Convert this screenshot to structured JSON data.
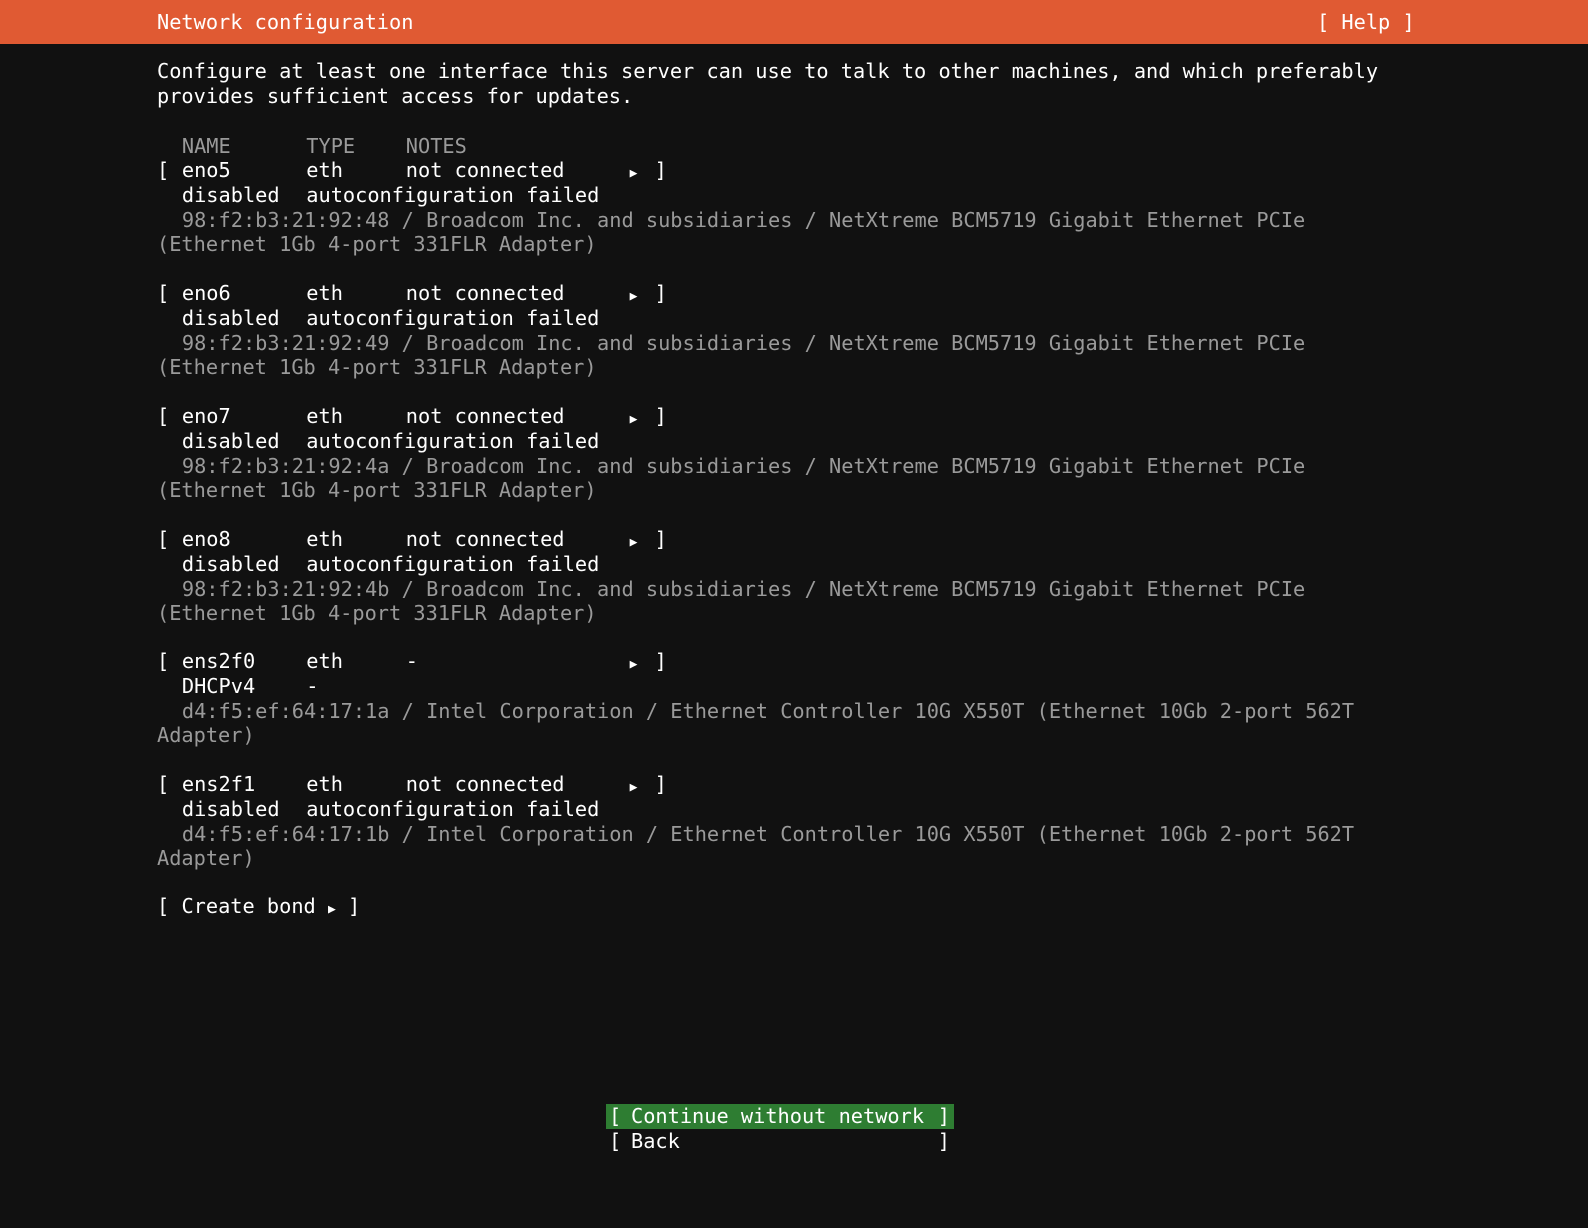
{
  "header": {
    "title": "Network configuration",
    "help_label": "[ Help ]",
    "color": "#e05a33"
  },
  "intro": "Configure at least one interface this server can use to talk to other machines, and which preferably\nprovides sufficient access for updates.",
  "columns": {
    "name": "NAME",
    "type": "TYPE",
    "notes": "NOTES"
  },
  "interfaces": [
    {
      "name": "eno5",
      "type": "eth",
      "notes": "not connected",
      "state": "disabled",
      "state_note": "autoconfiguration failed",
      "hw_line1": "98:f2:b3:21:92:48 / Broadcom Inc. and subsidiaries / NetXtreme BCM5719 Gigabit Ethernet PCIe",
      "hw_line2": "(Ethernet 1Gb 4-port 331FLR Adapter)"
    },
    {
      "name": "eno6",
      "type": "eth",
      "notes": "not connected",
      "state": "disabled",
      "state_note": "autoconfiguration failed",
      "hw_line1": "98:f2:b3:21:92:49 / Broadcom Inc. and subsidiaries / NetXtreme BCM5719 Gigabit Ethernet PCIe",
      "hw_line2": "(Ethernet 1Gb 4-port 331FLR Adapter)"
    },
    {
      "name": "eno7",
      "type": "eth",
      "notes": "not connected",
      "state": "disabled",
      "state_note": "autoconfiguration failed",
      "hw_line1": "98:f2:b3:21:92:4a / Broadcom Inc. and subsidiaries / NetXtreme BCM5719 Gigabit Ethernet PCIe",
      "hw_line2": "(Ethernet 1Gb 4-port 331FLR Adapter)"
    },
    {
      "name": "eno8",
      "type": "eth",
      "notes": "not connected",
      "state": "disabled",
      "state_note": "autoconfiguration failed",
      "hw_line1": "98:f2:b3:21:92:4b / Broadcom Inc. and subsidiaries / NetXtreme BCM5719 Gigabit Ethernet PCIe",
      "hw_line2": "(Ethernet 1Gb 4-port 331FLR Adapter)"
    },
    {
      "name": "ens2f0",
      "type": "eth",
      "notes": "-",
      "state": "DHCPv4",
      "state_note": "-",
      "hw_line1": "d4:f5:ef:64:17:1a / Intel Corporation / Ethernet Controller 10G X550T (Ethernet 10Gb 2-port 562T",
      "hw_line2": "Adapter)"
    },
    {
      "name": "ens2f1",
      "type": "eth",
      "notes": "not connected",
      "state": "disabled",
      "state_note": "autoconfiguration failed",
      "hw_line1": "d4:f5:ef:64:17:1b / Intel Corporation / Ethernet Controller 10G X550T (Ethernet 10Gb 2-port 562T",
      "hw_line2": "Adapter)"
    }
  ],
  "bracket_open": "[",
  "bracket_close": "]",
  "arrow_glyph": "▶",
  "create_bond": {
    "label": "Create bond"
  },
  "buttons": {
    "continue_label": "Continue without network",
    "back_label": "Back",
    "primary_color": "#2e7d32"
  }
}
